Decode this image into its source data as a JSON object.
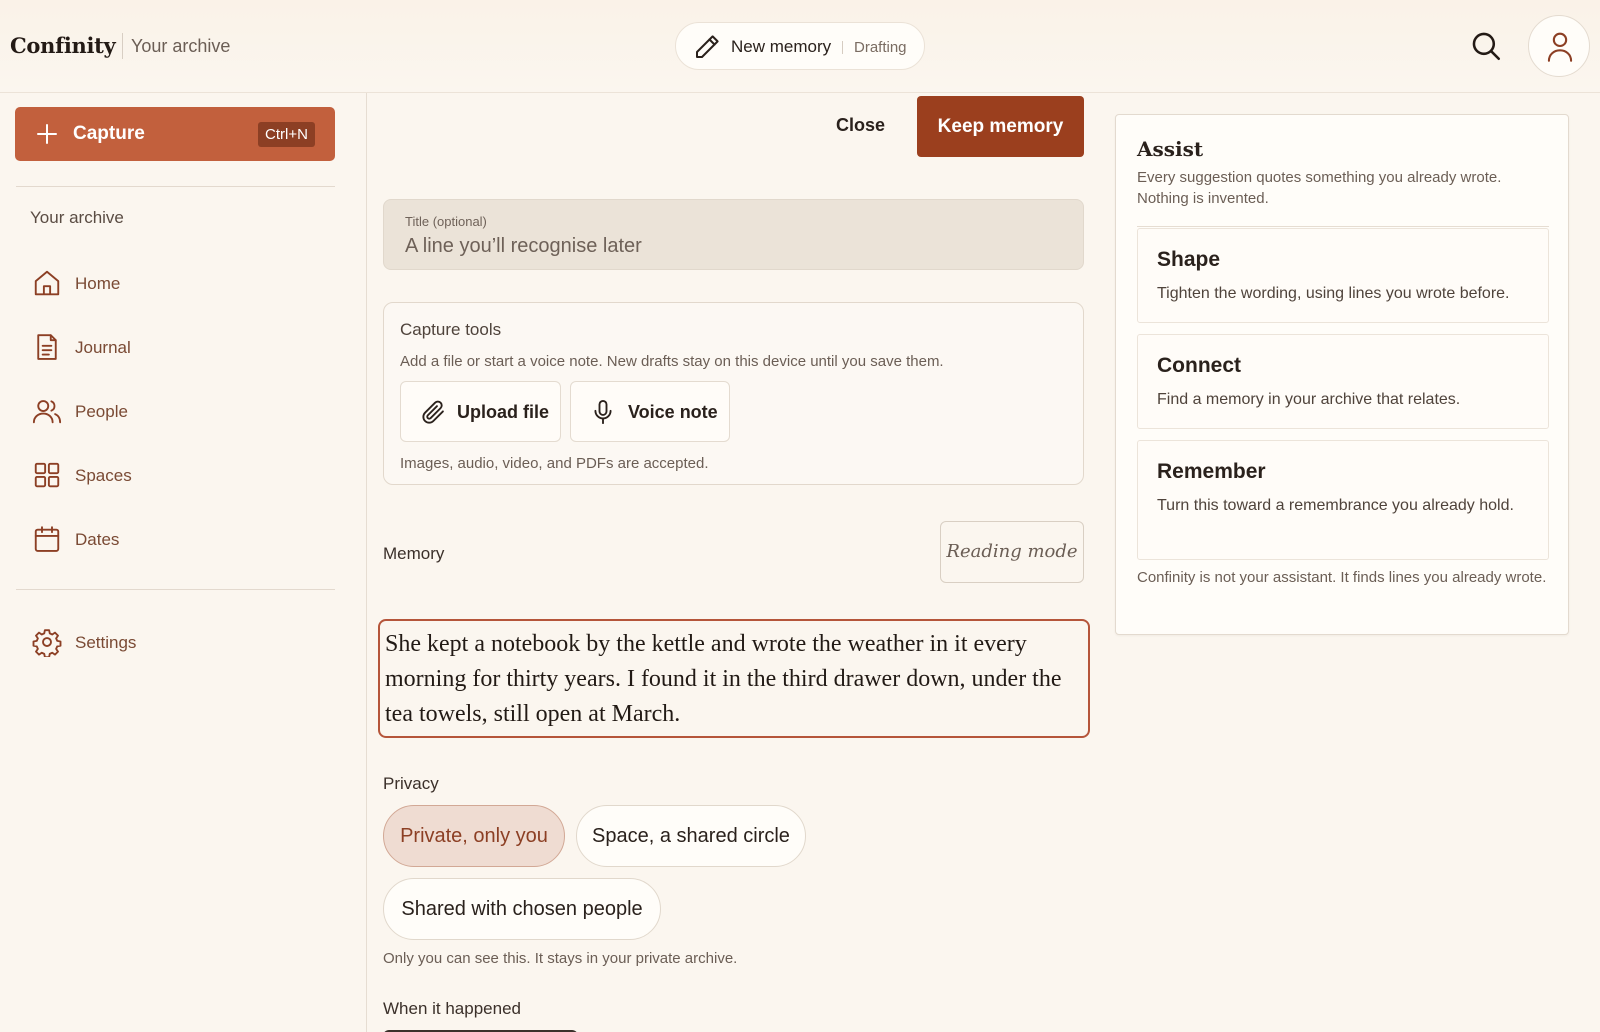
{
  "header": {
    "brand": "Confinity",
    "brand_sub": "Your archive",
    "draft_title": "New memory",
    "draft_status": "Drafting"
  },
  "sidebar": {
    "capture_label": "Capture",
    "capture_shortcut": "Ctrl+N",
    "section_label": "Your archive",
    "items": [
      {
        "label": "Home",
        "icon": "home-icon"
      },
      {
        "label": "Journal",
        "icon": "journal-icon"
      },
      {
        "label": "People",
        "icon": "people-icon"
      },
      {
        "label": "Spaces",
        "icon": "spaces-icon"
      },
      {
        "label": "Dates",
        "icon": "calendar-icon"
      }
    ],
    "settings_label": "Settings"
  },
  "editor": {
    "close_label": "Close",
    "keep_label": "Keep memory",
    "title_label": "Title (optional)",
    "title_placeholder": "A line you’ll recognise later",
    "tools": {
      "title": "Capture tools",
      "description": "Add a file or start a voice note. New drafts stay on this device until you save them.",
      "upload_label": "Upload file",
      "voice_label": "Voice note",
      "note": "Images, audio, video, and PDFs are accepted."
    },
    "memory_label": "Memory",
    "reading_mode_label": "Reading mode",
    "memory_text": "She kept a notebook by the kettle and wrote the weather in it every morning for thirty years. I found it in the third drawer down, under the tea towels, still open at March.",
    "privacy_label": "Privacy",
    "privacy_options": [
      {
        "label": "Private, only you",
        "selected": true
      },
      {
        "label": "Space, a shared circle",
        "selected": false
      },
      {
        "label": "Shared with chosen people",
        "selected": false
      }
    ],
    "privacy_hint": "Only you can see this. It stays in your private archive.",
    "when_label": "When it happened"
  },
  "assist": {
    "title": "Assist",
    "description": "Every suggestion quotes something you already wrote. Nothing is invented.",
    "suggestions": [
      {
        "title": "Shape",
        "description": "Tighten the wording, using lines you wrote before."
      },
      {
        "title": "Connect",
        "description": "Find a memory in your archive that relates."
      },
      {
        "title": "Remember",
        "description": "Turn this toward a remembrance you already hold."
      }
    ],
    "footer": "Confinity is not your assistant. It finds lines you already wrote."
  },
  "colors": {
    "accent": "#c2603d",
    "accent_dark": "#9b3f1e",
    "background": "#fbf6ef"
  }
}
